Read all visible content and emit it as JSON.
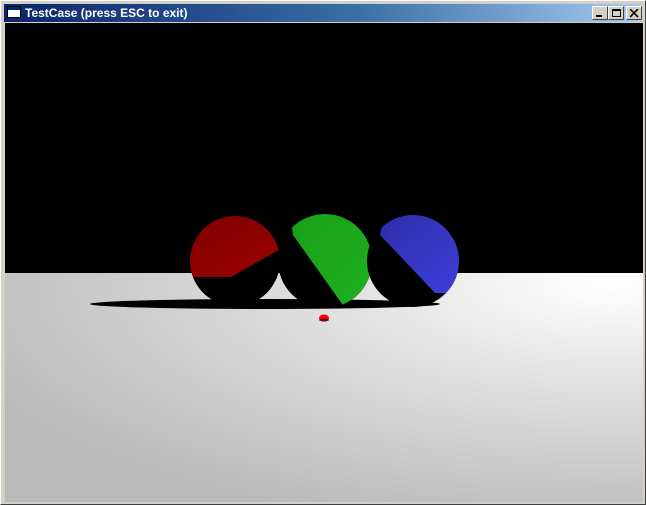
{
  "window": {
    "title": "TestCase (press ESC to exit)",
    "controls": {
      "minimize": "minimize-icon",
      "maximize": "maximize-icon",
      "close": "close-icon"
    },
    "colors": {
      "titlebar_start": "#0a246a",
      "titlebar_end": "#a6caf0"
    }
  },
  "scene": {
    "background": "#000000",
    "floor_color": "#e6e6e6",
    "spheres": [
      {
        "name": "red-sphere",
        "color": "#8b0000"
      },
      {
        "name": "green-sphere",
        "color": "#1aa31a"
      },
      {
        "name": "blue-sphere",
        "color": "#3434c4"
      }
    ],
    "marker_color": "#ff0000"
  }
}
